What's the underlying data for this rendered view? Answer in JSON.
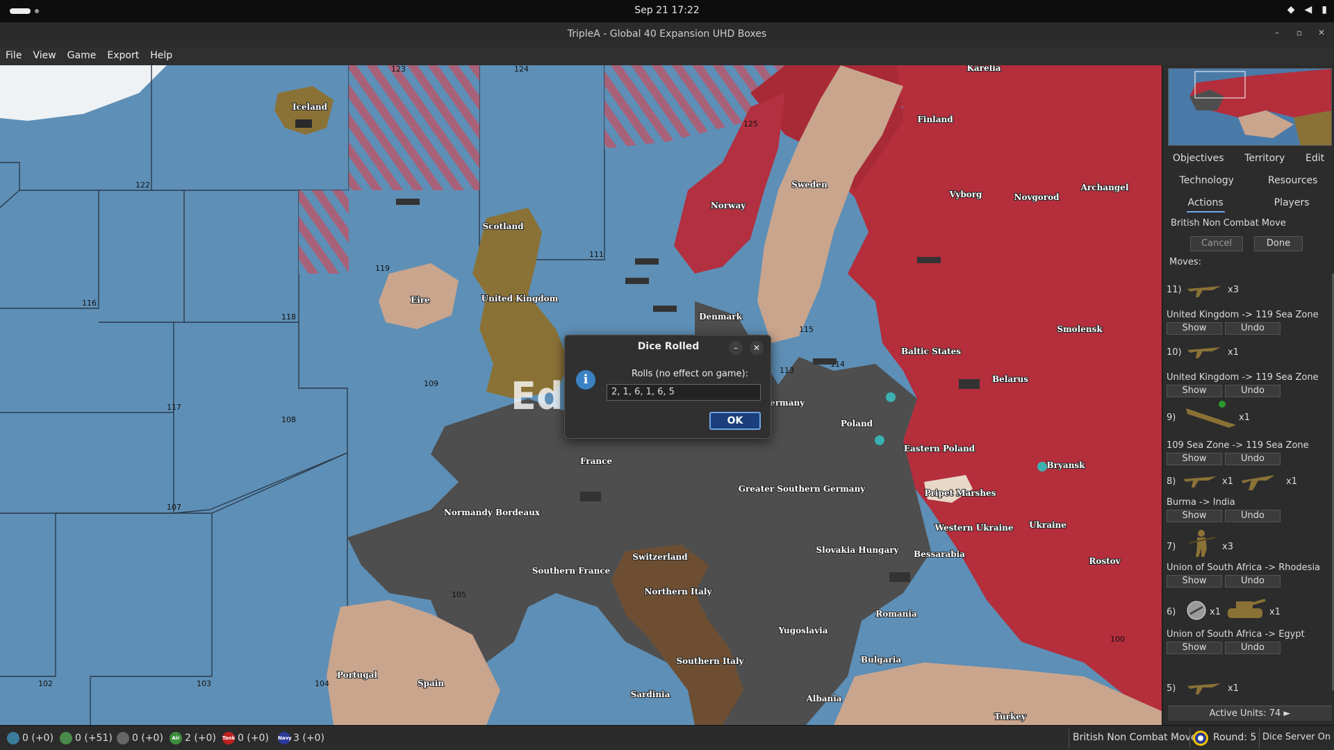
{
  "system": {
    "clock": "Sep 21  17:22"
  },
  "window": {
    "title": "TripleA - Global 40 Expansion UHD Boxes"
  },
  "menu": [
    "File",
    "View",
    "Game",
    "Export",
    "Help"
  ],
  "map": {
    "edit_mode": "Edit Mode",
    "sea_zones": [
      "123",
      "124",
      "125",
      "122",
      "116",
      "118",
      "119",
      "111",
      "117",
      "108",
      "109",
      "107",
      "105",
      "102",
      "103",
      "104",
      "113",
      "114",
      "115",
      "100"
    ],
    "territories": [
      "Karelia",
      "Finland",
      "Iceland",
      "Sweden",
      "Norway",
      "Archangel",
      "Novgorod",
      "Vyborg",
      "Scotland",
      "United Kingdom",
      "Eire",
      "Denmark",
      "Baltic States",
      "Smolensk",
      "Belarus",
      "Poland",
      "Eastern Poland",
      "Pripet Marshes",
      "Bryansk",
      "France",
      "Normandy Bordeaux",
      "Greater Southern Germany",
      "Western Ukraine",
      "Ukraine",
      "Switzerland",
      "Slovakia Hungary",
      "Bessarabia",
      "Rostov",
      "Southern France",
      "Northern Italy",
      "Romania",
      "Yugoslavia",
      "Portugal",
      "Spain",
      "Southern Italy",
      "Bulgaria",
      "Sardinia",
      "Albania",
      "Turkey",
      "Germany"
    ]
  },
  "dialog": {
    "title": "Dice Rolled",
    "message": "Rolls (no effect on game):",
    "rolls": "2, 1, 6, 1, 6, 5",
    "ok": "OK"
  },
  "panel": {
    "tabs_row1": [
      "Objectives",
      "Territory",
      "Edit"
    ],
    "tabs_row2": [
      "Technology",
      "Resources"
    ],
    "tabs_row3": [
      "Actions",
      "Players"
    ],
    "phase": "British Non Combat Move",
    "cancel": "Cancel",
    "done": "Done",
    "moves_label": "Moves:",
    "moves": [
      {
        "num": "11)",
        "qty": "x3",
        "qty2": "",
        "route": "United Kingdom -> 119 Sea Zone",
        "icon": "fighter-icon",
        "icon2": ""
      },
      {
        "num": "10)",
        "qty": "x1",
        "qty2": "",
        "route": "United Kingdom -> 119 Sea Zone",
        "icon": "fighter-icon",
        "icon2": ""
      },
      {
        "num": "9)",
        "qty": "x1",
        "qty2": "",
        "route": "109 Sea Zone -> 119 Sea Zone",
        "icon": "battleship-icon",
        "icon2": ""
      },
      {
        "num": "8)",
        "qty": "x1",
        "qty2": "x1",
        "route": "Burma -> India",
        "icon": "fighter-icon",
        "icon2": "bomber-icon"
      },
      {
        "num": "7)",
        "qty": "x3",
        "qty2": "",
        "route": "Union of South Africa -> Rhodesia",
        "icon": "infantry-icon",
        "icon2": ""
      },
      {
        "num": "6)",
        "qty": "x1",
        "qty2": "x1",
        "route": "Union of South Africa -> Egypt",
        "icon": "aa-gun-icon",
        "icon2": "tank-icon"
      },
      {
        "num": "5)",
        "qty": "x1",
        "qty2": "",
        "route": "",
        "icon": "fighter-icon",
        "icon2": ""
      }
    ],
    "show": "Show",
    "undo": "Undo",
    "active_units": "Active Units: 74 ►"
  },
  "status": {
    "resources": [
      {
        "value": "0 (+0)",
        "icon": "infantry-res-icon",
        "color": "#3a7c9a"
      },
      {
        "value": "0 (+51)",
        "icon": "pu-res-icon",
        "color": "#4a8a4a"
      },
      {
        "value": "0 (+0)",
        "icon": "skull-res-icon",
        "color": "#666666"
      },
      {
        "value": "2 (+0)",
        "icon": "air-res-icon",
        "color": "#3c8c3c"
      },
      {
        "value": "0 (+0)",
        "icon": "tank-res-icon",
        "color": "#c02020"
      },
      {
        "value": "3 (+0)",
        "icon": "navy-res-icon",
        "color": "#2a3a9a"
      }
    ],
    "phase": "British Non Combat Move",
    "round": "Round: 5",
    "dice": "Dice Server On"
  },
  "colors": {
    "sea": "#5e8fb6",
    "axis": "#4e4e4e",
    "russia": "#b42e3c",
    "uk": "#8a7236",
    "neutral": "#c9a58e",
    "accent": "#6fa5e8"
  }
}
